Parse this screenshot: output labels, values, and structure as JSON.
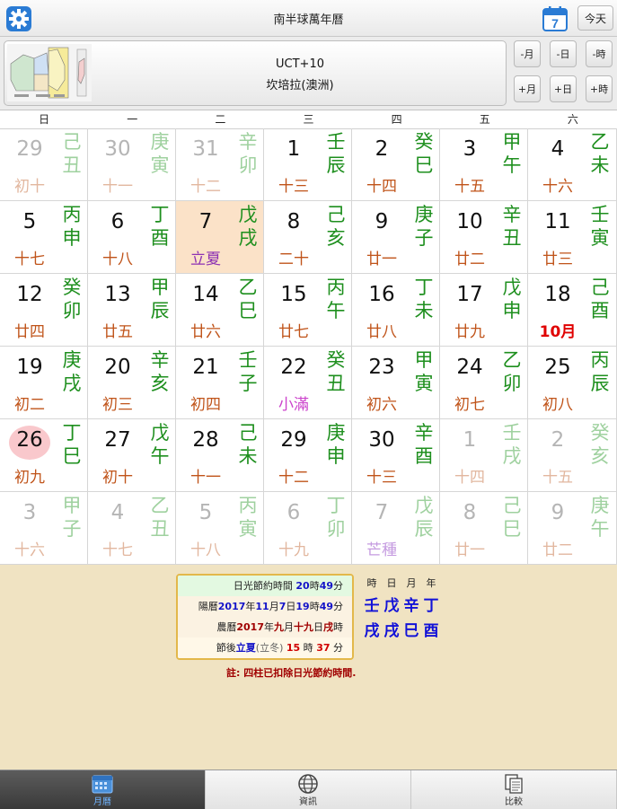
{
  "header": {
    "title": "南半球萬年曆",
    "calendar_icon_day": "7",
    "today_label": "今天",
    "accent": "#2a7bd4"
  },
  "location": {
    "tz": "UCT+10",
    "city": "坎培拉(澳洲)"
  },
  "nav": {
    "prev_month": "-月",
    "prev_day": "-日",
    "prev_hour": "-時",
    "next_month": "+月",
    "next_day": "+日",
    "next_hour": "+時"
  },
  "weekdays": [
    "日",
    "一",
    "二",
    "三",
    "四",
    "五",
    "六"
  ],
  "calendar": {
    "weeks": [
      [
        {
          "d": "29",
          "lunar": "初十",
          "gz": [
            "己",
            "丑"
          ],
          "dim": true
        },
        {
          "d": "30",
          "lunar": "十一",
          "gz": [
            "庚",
            "寅"
          ],
          "dim": true
        },
        {
          "d": "31",
          "lunar": "十二",
          "gz": [
            "辛",
            "卯"
          ],
          "dim": true
        },
        {
          "d": "1",
          "lunar": "十三",
          "gz": [
            "壬",
            "辰"
          ]
        },
        {
          "d": "2",
          "lunar": "十四",
          "gz": [
            "癸",
            "巳"
          ]
        },
        {
          "d": "3",
          "lunar": "十五",
          "gz": [
            "甲",
            "午"
          ]
        },
        {
          "d": "4",
          "lunar": "十六",
          "gz": [
            "乙",
            "未"
          ]
        }
      ],
      [
        {
          "d": "5",
          "lunar": "十七",
          "gz": [
            "丙",
            "申"
          ]
        },
        {
          "d": "6",
          "lunar": "十八",
          "gz": [
            "丁",
            "酉"
          ]
        },
        {
          "d": "7",
          "lunar": "立夏",
          "gz": [
            "戊",
            "戌"
          ],
          "term": true,
          "selected": true
        },
        {
          "d": "8",
          "lunar": "二十",
          "gz": [
            "己",
            "亥"
          ]
        },
        {
          "d": "9",
          "lunar": "廿一",
          "gz": [
            "庚",
            "子"
          ]
        },
        {
          "d": "10",
          "lunar": "廿二",
          "gz": [
            "辛",
            "丑"
          ]
        },
        {
          "d": "11",
          "lunar": "廿三",
          "gz": [
            "壬",
            "寅"
          ]
        }
      ],
      [
        {
          "d": "12",
          "lunar": "廿四",
          "gz": [
            "癸",
            "卯"
          ]
        },
        {
          "d": "13",
          "lunar": "廿五",
          "gz": [
            "甲",
            "辰"
          ]
        },
        {
          "d": "14",
          "lunar": "廿六",
          "gz": [
            "乙",
            "巳"
          ]
        },
        {
          "d": "15",
          "lunar": "廿七",
          "gz": [
            "丙",
            "午"
          ]
        },
        {
          "d": "16",
          "lunar": "廿八",
          "gz": [
            "丁",
            "未"
          ]
        },
        {
          "d": "17",
          "lunar": "廿九",
          "gz": [
            "戊",
            "申"
          ]
        },
        {
          "d": "18",
          "lunar": "10月",
          "gz": [
            "己",
            "酉"
          ],
          "month": true
        }
      ],
      [
        {
          "d": "19",
          "lunar": "初二",
          "gz": [
            "庚",
            "戌"
          ]
        },
        {
          "d": "20",
          "lunar": "初三",
          "gz": [
            "辛",
            "亥"
          ]
        },
        {
          "d": "21",
          "lunar": "初四",
          "gz": [
            "壬",
            "子"
          ]
        },
        {
          "d": "22",
          "lunar": "小滿",
          "gz": [
            "癸",
            "丑"
          ],
          "term": true,
          "pink": true
        },
        {
          "d": "23",
          "lunar": "初六",
          "gz": [
            "甲",
            "寅"
          ]
        },
        {
          "d": "24",
          "lunar": "初七",
          "gz": [
            "乙",
            "卯"
          ]
        },
        {
          "d": "25",
          "lunar": "初八",
          "gz": [
            "丙",
            "辰"
          ]
        }
      ],
      [
        {
          "d": "26",
          "lunar": "初九",
          "gz": [
            "丁",
            "巳"
          ],
          "today": true
        },
        {
          "d": "27",
          "lunar": "初十",
          "gz": [
            "戊",
            "午"
          ]
        },
        {
          "d": "28",
          "lunar": "十一",
          "gz": [
            "己",
            "未"
          ]
        },
        {
          "d": "29",
          "lunar": "十二",
          "gz": [
            "庚",
            "申"
          ]
        },
        {
          "d": "30",
          "lunar": "十三",
          "gz": [
            "辛",
            "酉"
          ]
        },
        {
          "d": "1",
          "lunar": "十四",
          "gz": [
            "壬",
            "戌"
          ],
          "dim": true
        },
        {
          "d": "2",
          "lunar": "十五",
          "gz": [
            "癸",
            "亥"
          ],
          "dim": true
        }
      ],
      [
        {
          "d": "3",
          "lunar": "十六",
          "gz": [
            "甲",
            "子"
          ],
          "dim": true
        },
        {
          "d": "4",
          "lunar": "十七",
          "gz": [
            "乙",
            "丑"
          ],
          "dim": true
        },
        {
          "d": "5",
          "lunar": "十八",
          "gz": [
            "丙",
            "寅"
          ],
          "dim": true
        },
        {
          "d": "6",
          "lunar": "十九",
          "gz": [
            "丁",
            "卯"
          ],
          "dim": true
        },
        {
          "d": "7",
          "lunar": "芒種",
          "gz": [
            "戊",
            "辰"
          ],
          "dim": true,
          "term": true
        },
        {
          "d": "8",
          "lunar": "廿一",
          "gz": [
            "己",
            "巳"
          ],
          "dim": true
        },
        {
          "d": "9",
          "lunar": "廿二",
          "gz": [
            "庚",
            "午"
          ],
          "dim": true
        }
      ]
    ]
  },
  "info": {
    "dst": {
      "label": "日光節約時間 ",
      "h": "20",
      "hu": "時",
      "m": "49",
      "mu": "分"
    },
    "solar": {
      "label": "陽曆",
      "y": "2017",
      "yu": "年",
      "mo": "11",
      "mou": "月",
      "d": "7",
      "du": "日",
      "h": "19",
      "hu": "時",
      "m": "49",
      "mu": "分"
    },
    "lunar": {
      "label": "農曆",
      "y": "2017",
      "yu": "年",
      "mo": "九",
      "mou": "月",
      "d": "十九",
      "du": "日",
      "h": "戌",
      "hu": "時"
    },
    "jieqi": {
      "label": "節後",
      "term": "立夏",
      "alt": "(立冬)",
      "h": "15",
      "hu": " 時 ",
      "m": "37",
      "mu": " 分"
    },
    "note": "註: 四柱已扣除日光節約時間."
  },
  "pillars": {
    "labels": [
      "時",
      "日",
      "月",
      "年"
    ],
    "stems": [
      "壬",
      "戊",
      "辛",
      "丁"
    ],
    "branches": [
      "戌",
      "戌",
      "巳",
      "酉"
    ]
  },
  "tabs": [
    {
      "label": "月曆",
      "icon": "calendar-icon",
      "active": true
    },
    {
      "label": "資訊",
      "icon": "globe-icon",
      "active": false
    },
    {
      "label": "比較",
      "icon": "compare-icon",
      "active": false
    }
  ]
}
